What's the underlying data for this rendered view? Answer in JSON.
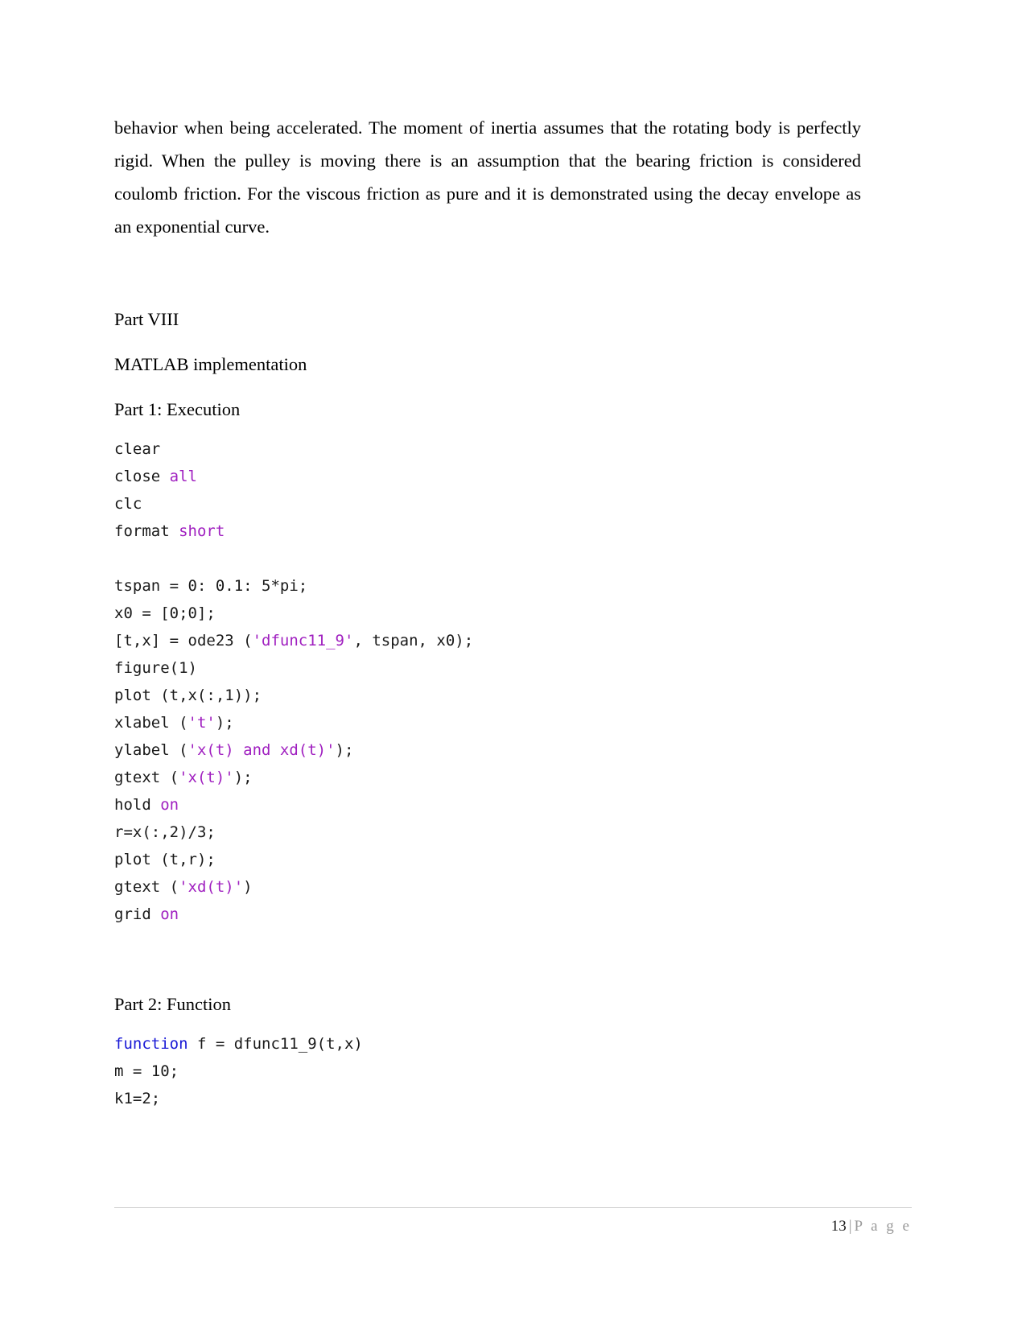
{
  "document": {
    "paragraph": "behavior when being accelerated. The moment of inertia assumes that the rotating body is perfectly rigid. When the pulley is moving there is an assumption that the bearing friction is considered coulomb friction. For the viscous friction as pure and it is demonstrated using the decay envelope as an exponential curve.",
    "part_label": "Part VIII",
    "section_title": "MATLAB implementation",
    "part1_title": "Part 1: Execution",
    "part2_title": "Part 2: Function",
    "code_part1": [
      [
        {
          "t": "clear",
          "c": "default"
        }
      ],
      [
        {
          "t": "close ",
          "c": "default"
        },
        {
          "t": "all",
          "c": "keyword-purple"
        }
      ],
      [
        {
          "t": "clc",
          "c": "default"
        }
      ],
      [
        {
          "t": "format ",
          "c": "default"
        },
        {
          "t": "short",
          "c": "keyword-purple"
        }
      ],
      [],
      [
        {
          "t": "tspan = 0: 0.1: 5*pi;",
          "c": "default"
        }
      ],
      [
        {
          "t": "x0 = [0;0];",
          "c": "default"
        }
      ],
      [
        {
          "t": "[t,x] = ode23 (",
          "c": "default"
        },
        {
          "t": "'dfunc11_9'",
          "c": "string"
        },
        {
          "t": ", tspan, x0);",
          "c": "default"
        }
      ],
      [
        {
          "t": "figure(1)",
          "c": "default"
        }
      ],
      [
        {
          "t": "plot (t,x(:,1));",
          "c": "default"
        }
      ],
      [
        {
          "t": "xlabel (",
          "c": "default"
        },
        {
          "t": "'t'",
          "c": "string"
        },
        {
          "t": ");",
          "c": "default"
        }
      ],
      [
        {
          "t": "ylabel (",
          "c": "default"
        },
        {
          "t": "'x(t) and xd(t)'",
          "c": "string"
        },
        {
          "t": ");",
          "c": "default"
        }
      ],
      [
        {
          "t": "gtext (",
          "c": "default"
        },
        {
          "t": "'x(t)'",
          "c": "string"
        },
        {
          "t": ");",
          "c": "default"
        }
      ],
      [
        {
          "t": "hold ",
          "c": "default"
        },
        {
          "t": "on",
          "c": "keyword-purple"
        }
      ],
      [
        {
          "t": "r=x(:,2)/3;",
          "c": "default"
        }
      ],
      [
        {
          "t": "plot (t,r);",
          "c": "default"
        }
      ],
      [
        {
          "t": "gtext (",
          "c": "default"
        },
        {
          "t": "'xd(t)'",
          "c": "string"
        },
        {
          "t": ")",
          "c": "default"
        }
      ],
      [
        {
          "t": "grid ",
          "c": "default"
        },
        {
          "t": "on",
          "c": "keyword-purple"
        }
      ]
    ],
    "code_part2": [
      [
        {
          "t": "function",
          "c": "keyword-blue"
        },
        {
          "t": " f = dfunc11_9(t,x)",
          "c": "default"
        }
      ],
      [
        {
          "t": "m = 10;",
          "c": "default"
        }
      ],
      [
        {
          "t": "k1=2;",
          "c": "default"
        }
      ]
    ]
  },
  "footer": {
    "page_number": "13",
    "separator": "|",
    "page_word": "P a g e"
  },
  "colors": {
    "text": "#000000",
    "code_default": "#1a1a1a",
    "code_purple": "#a020c0",
    "code_blue": "#1a1ad6",
    "footer_gray": "#9a9a9a",
    "rule_gray": "#cfcfcf"
  }
}
